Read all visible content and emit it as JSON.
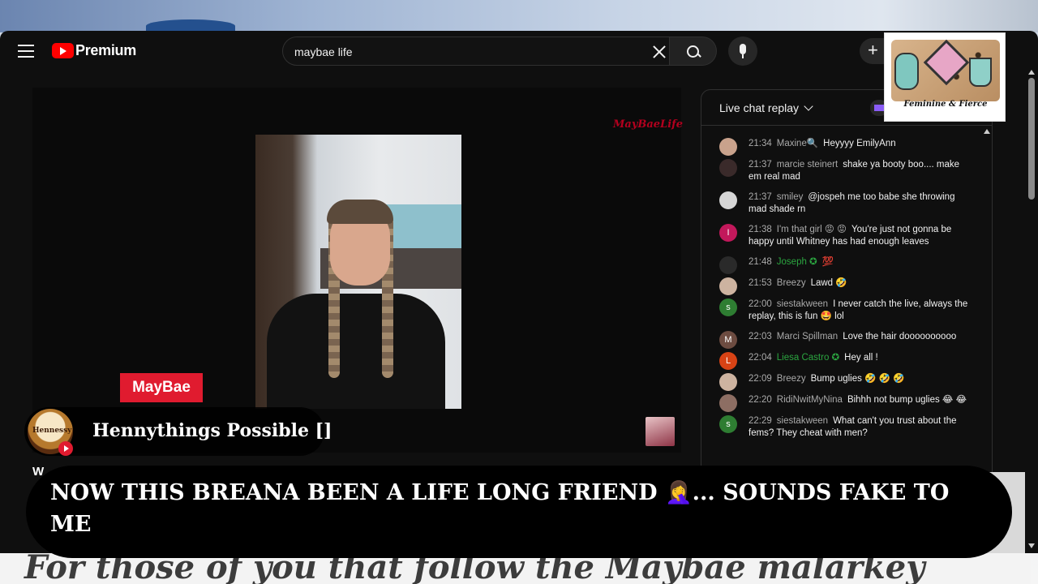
{
  "browser": {
    "brand": "Premium",
    "search": {
      "value": "maybae life"
    }
  },
  "sticker": {
    "caption": "Feminine & Fierce"
  },
  "player": {
    "overlay_label": "MayBae",
    "watermark": "MayBaeLife",
    "below_text": "W"
  },
  "chat": {
    "title": "Live chat replay",
    "messages": [
      {
        "time": "21:34",
        "author": "Maxine🔍",
        "text": "Heyyyy EmilyAnn",
        "avatar_color": "#c9a28c",
        "author_color": "default"
      },
      {
        "time": "21:37",
        "author": "marcie steinert",
        "text": "shake ya booty boo.... make em real mad",
        "avatar_color": "#3a2a2a",
        "author_color": "default"
      },
      {
        "time": "21:37",
        "author": "smiley",
        "text": "@jospeh me too babe she throwing mad shade rn",
        "avatar_color": "#d6d6d6",
        "author_color": "default"
      },
      {
        "time": "21:38",
        "author": "I'm that girl 😡 😡",
        "text": "You're just not gonna be happy until Whitney has had enough leaves",
        "avatar_color": "#c2185b",
        "avatar_letter": "I",
        "author_color": "default"
      },
      {
        "time": "21:48",
        "author": "Joseph ✪",
        "text": "💯",
        "avatar_color": "#2a2a2a",
        "author_color": "green"
      },
      {
        "time": "21:53",
        "author": "Breezy",
        "text": "Lawd 🤣",
        "avatar_color": "#cdb3a0",
        "author_color": "default"
      },
      {
        "time": "22:00",
        "author": "siestakween",
        "text": "I never catch the live, always the replay, this is fun 🤩 lol",
        "avatar_color": "#2e7d32",
        "avatar_letter": "s",
        "author_color": "default"
      },
      {
        "time": "22:03",
        "author": "Marci Spillman",
        "text": "Love the hair doooooooooo",
        "avatar_color": "#6d4c41",
        "avatar_letter": "M",
        "author_color": "default"
      },
      {
        "time": "22:04",
        "author": "Liesa Castro ✪",
        "text": "Hey all !",
        "avatar_color": "#d84315",
        "avatar_letter": "L",
        "author_color": "green"
      },
      {
        "time": "22:09",
        "author": "Breezy",
        "text": "Bump uglies 🤣 🤣 🤣",
        "avatar_color": "#cdb3a0",
        "author_color": "default"
      },
      {
        "time": "22:20",
        "author": "RidiNwitMyNina",
        "text": "Bihhh not bump uglies 😂 😂",
        "avatar_color": "#8d6e63",
        "author_color": "default"
      },
      {
        "time": "22:29",
        "author": "siestakween",
        "text": "What can't you trust about the fems? They cheat with men?",
        "avatar_color": "#2e7d32",
        "avatar_letter": "s",
        "author_color": "default"
      }
    ]
  },
  "live_comment": {
    "name": "Hennythings Possible []",
    "avatar_text": "Hennessy",
    "text": "NOW THIS BREANA BEEN A LIFE LONG FRIEND 🤦‍♀️... SOUNDS FAKE TO ME"
  },
  "background_caption": "For those of you that follow the Maybae malarkey"
}
